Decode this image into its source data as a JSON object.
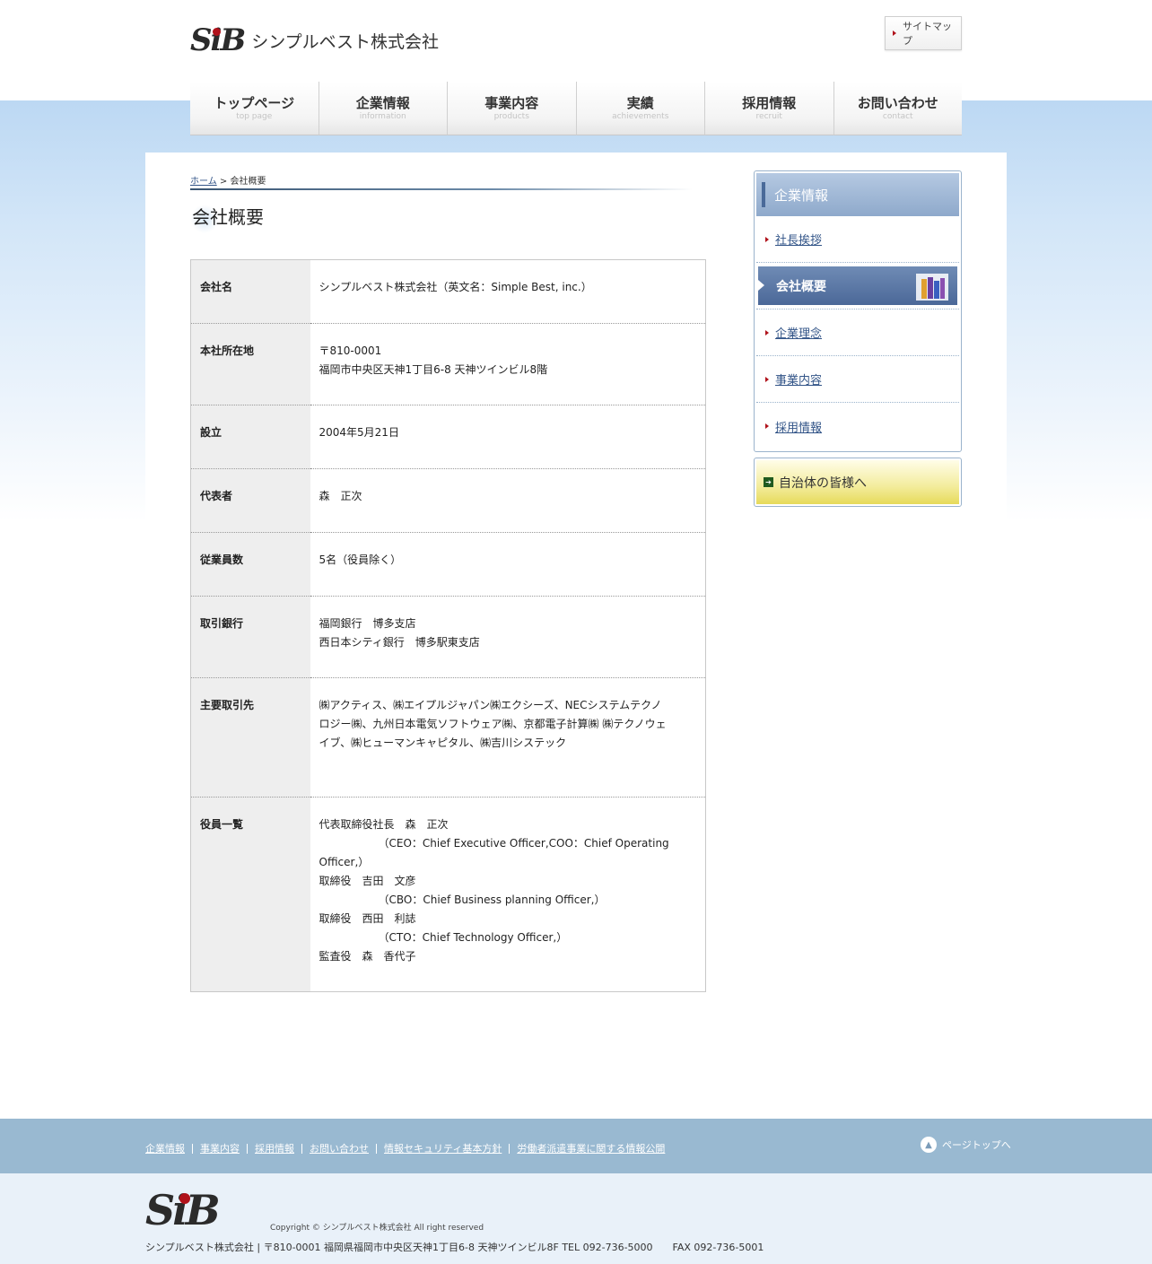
{
  "header": {
    "logo_mark": "SiB",
    "company_name": "シンプルベスト株式会社",
    "sitemap_label": "サイトマップ"
  },
  "gnav": [
    {
      "ja": "トップページ",
      "en": "top page"
    },
    {
      "ja": "企業情報",
      "en": "information"
    },
    {
      "ja": "事業内容",
      "en": "products"
    },
    {
      "ja": "実績",
      "en": "achievements"
    },
    {
      "ja": "採用情報",
      "en": "recruit"
    },
    {
      "ja": "お問い合わせ",
      "en": "contact"
    }
  ],
  "breadcrumb": {
    "home": "ホーム",
    "separator": " > ",
    "current": "会社概要"
  },
  "page_title": "会社概要",
  "table": [
    {
      "label": "会社名",
      "value": "シンプルベスト株式会社（英文名：Simple Best, inc.）"
    },
    {
      "label": "本社所在地",
      "value": "〒810-0001\n福岡市中央区天神1丁目6-8 天神ツインビル8階"
    },
    {
      "label": "設立",
      "value": "2004年5月21日"
    },
    {
      "label": "代表者",
      "value": "森　正次"
    },
    {
      "label": "従業員数",
      "value": "5名（役員除く）"
    },
    {
      "label": "取引銀行",
      "value": "福岡銀行　博多支店\n西日本シティ銀行　博多駅東支店"
    },
    {
      "label": "主要取引先",
      "value": "㈱アクティス、㈱エイプルジャパン㈱エクシーズ、NECシステムテクノロジー㈱、九州日本電気ソフトウェア㈱、京都電子計算㈱ ㈱テクノウェイブ、㈱ヒューマンキャピタル、㈱吉川システック"
    },
    {
      "label": "役員一覧",
      "value": "代表取締役社長　森　正次\n　　　　　　（CEO：Chief Executive Officer,COO：Chief Operating Officer,）\n取締役　吉田　文彦\n　　　　　　（CBO：Chief Business planning Officer,）\n取締役　西田　利誌\n　　　　　　（CTO：Chief Technology Officer,）\n監査役　森　香代子"
    }
  ],
  "sidebar": {
    "heading": "企業情報",
    "items": [
      "社長挨拶",
      "会社概要",
      "企業理念",
      "事業内容",
      "採用情報"
    ],
    "active": "会社概要",
    "municipal_banner": "自治体の皆様へ"
  },
  "footer": {
    "links": [
      "企業情報",
      "事業内容",
      "採用情報",
      "お問い合わせ",
      "情報セキュリティ基本方針",
      "労働者派遣事業に関する情報公開"
    ],
    "pagetop": "ページトップへ",
    "logo_mark": "SiB",
    "copyright": "Copyright © シンプルベスト株式会社 All right reserved",
    "address": "シンプルベスト株式会社 | 〒810-0001 福岡県福岡市中央区天神1丁目6-8 天神ツインビル8F TEL 092-736-5000　　FAX 092-736-5001"
  },
  "colors": {
    "accent_red": "#b0121b",
    "nav_blue": "#4b6898",
    "footer_blue": "#99b9d1",
    "link": "#335588"
  }
}
